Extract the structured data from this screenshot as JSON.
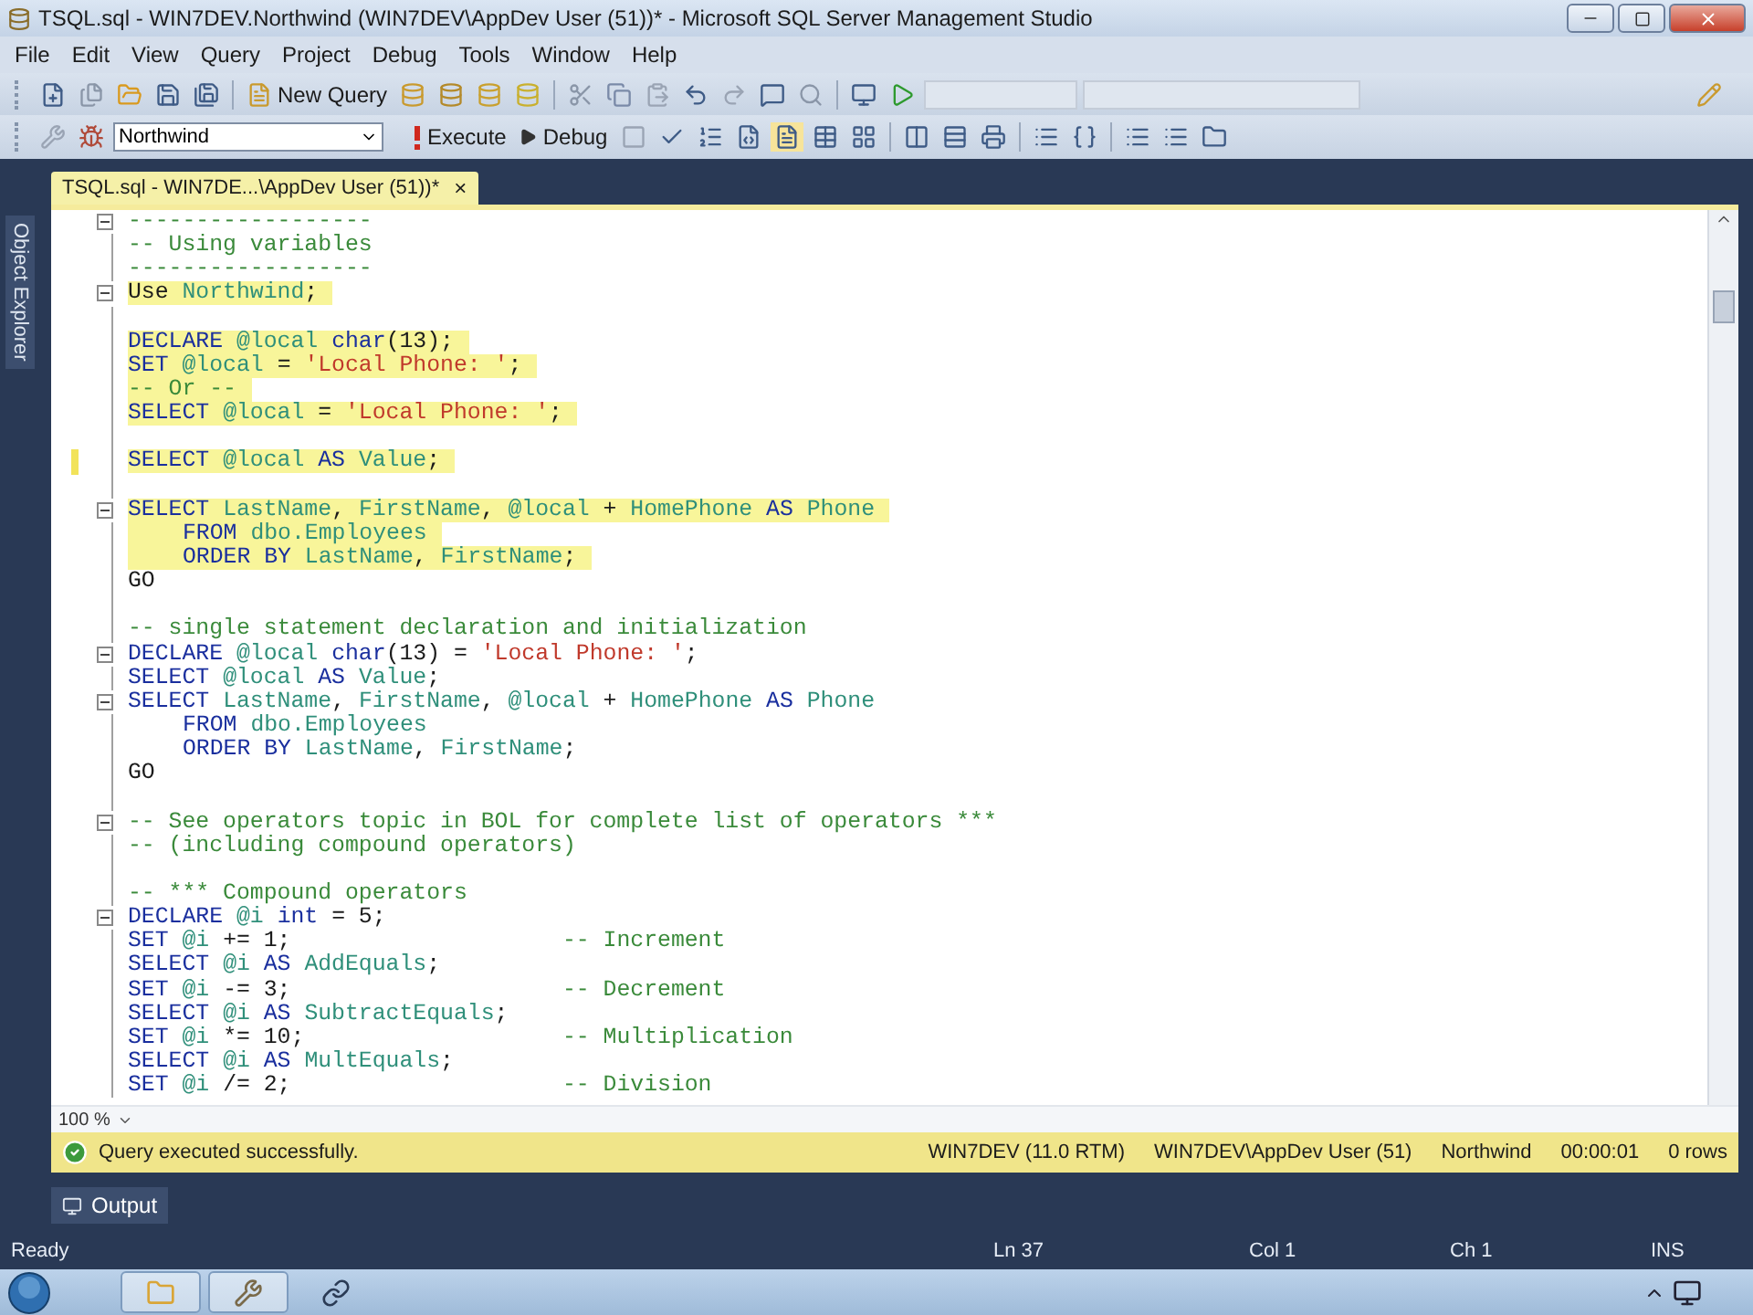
{
  "window": {
    "title": "TSQL.sql - WIN7DEV.Northwind (WIN7DEV\\AppDev User (51))* - Microsoft SQL Server Management Studio"
  },
  "menu": [
    "File",
    "Edit",
    "View",
    "Query",
    "Project",
    "Debug",
    "Tools",
    "Window",
    "Help"
  ],
  "toolbar": {
    "new_query": "New Query"
  },
  "query_toolbar": {
    "database": "Northwind",
    "execute": "Execute",
    "debug": "Debug"
  },
  "side_tabs": [
    "Object Explorer"
  ],
  "document_tabs": [
    {
      "label": "TSQL.sql - WIN7DE...\\AppDev User (51))*",
      "close": "×",
      "selected": true
    }
  ],
  "editor": {
    "zoom": "100 %",
    "lines": [
      {
        "kind": "code",
        "fold": true,
        "highlighted": false,
        "changed": false,
        "tokens": [
          {
            "kind": "comment",
            "text": "------------------"
          }
        ]
      },
      {
        "kind": "code",
        "fold": false,
        "highlighted": false,
        "changed": false,
        "tokens": [
          {
            "kind": "comment",
            "text": "-- Using variables"
          }
        ]
      },
      {
        "kind": "code",
        "fold": false,
        "highlighted": false,
        "changed": false,
        "tokens": [
          {
            "kind": "comment",
            "text": "------------------"
          }
        ]
      },
      {
        "kind": "code",
        "fold": true,
        "highlighted": true,
        "changed": false,
        "tokens": [
          {
            "kind": "plain",
            "text": "Use "
          },
          {
            "kind": "identifier",
            "text": "Northwind"
          },
          {
            "kind": "plain",
            "text": ";"
          }
        ]
      },
      {
        "kind": "blank"
      },
      {
        "kind": "code",
        "fold": false,
        "highlighted": true,
        "changed": false,
        "tokens": [
          {
            "kind": "keyword",
            "text": "DECLARE "
          },
          {
            "kind": "variable",
            "text": "@local "
          },
          {
            "kind": "keyword",
            "text": "char"
          },
          {
            "kind": "plain",
            "text": "(13);"
          }
        ]
      },
      {
        "kind": "code",
        "fold": false,
        "highlighted": true,
        "changed": false,
        "tokens": [
          {
            "kind": "keyword",
            "text": "SET "
          },
          {
            "kind": "variable",
            "text": "@local "
          },
          {
            "kind": "plain",
            "text": "= "
          },
          {
            "kind": "string",
            "text": "'Local Phone: '"
          },
          {
            "kind": "plain",
            "text": ";"
          }
        ]
      },
      {
        "kind": "code",
        "fold": false,
        "highlighted": true,
        "changed": false,
        "tokens": [
          {
            "kind": "comment",
            "text": "-- Or --"
          }
        ]
      },
      {
        "kind": "code",
        "fold": false,
        "highlighted": true,
        "changed": false,
        "tokens": [
          {
            "kind": "keyword",
            "text": "SELECT "
          },
          {
            "kind": "variable",
            "text": "@local "
          },
          {
            "kind": "plain",
            "text": "= "
          },
          {
            "kind": "string",
            "text": "'Local Phone: '"
          },
          {
            "kind": "plain",
            "text": ";"
          }
        ]
      },
      {
        "kind": "blank"
      },
      {
        "kind": "code",
        "fold": false,
        "highlighted": true,
        "changed": true,
        "tokens": [
          {
            "kind": "keyword",
            "text": "SELECT "
          },
          {
            "kind": "variable",
            "text": "@local "
          },
          {
            "kind": "keyword",
            "text": "AS "
          },
          {
            "kind": "identifier",
            "text": "Value"
          },
          {
            "kind": "plain",
            "text": ";"
          }
        ]
      },
      {
        "kind": "blank"
      },
      {
        "kind": "code",
        "fold": true,
        "highlighted": true,
        "changed": false,
        "tokens": [
          {
            "kind": "keyword",
            "text": "SELECT "
          },
          {
            "kind": "identifier",
            "text": "LastName"
          },
          {
            "kind": "plain",
            "text": ", "
          },
          {
            "kind": "identifier",
            "text": "FirstName"
          },
          {
            "kind": "plain",
            "text": ", "
          },
          {
            "kind": "variable",
            "text": "@local "
          },
          {
            "kind": "plain",
            "text": "+ "
          },
          {
            "kind": "identifier",
            "text": "HomePhone "
          },
          {
            "kind": "keyword",
            "text": "AS "
          },
          {
            "kind": "identifier",
            "text": "Phone"
          }
        ]
      },
      {
        "kind": "code",
        "indented": true,
        "fold": false,
        "highlighted": true,
        "changed": false,
        "tokens": [
          {
            "kind": "keyword",
            "text": "FROM "
          },
          {
            "kind": "identifier",
            "text": "dbo.Employees"
          }
        ]
      },
      {
        "kind": "code",
        "indented": true,
        "fold": false,
        "highlighted": true,
        "changed": false,
        "tokens": [
          {
            "kind": "keyword",
            "text": "ORDER BY "
          },
          {
            "kind": "identifier",
            "text": "LastName"
          },
          {
            "kind": "plain",
            "text": ", "
          },
          {
            "kind": "identifier",
            "text": "FirstName"
          },
          {
            "kind": "plain",
            "text": ";"
          }
        ]
      },
      {
        "kind": "code",
        "fold": false,
        "highlighted": false,
        "changed": false,
        "tokens": [
          {
            "kind": "plain",
            "text": "GO"
          }
        ]
      },
      {
        "kind": "blank"
      },
      {
        "kind": "code",
        "fold": false,
        "highlighted": false,
        "changed": false,
        "tokens": [
          {
            "kind": "comment",
            "text": "-- single statement declaration and initialization"
          }
        ]
      },
      {
        "kind": "code",
        "fold": true,
        "highlighted": false,
        "changed": false,
        "tokens": [
          {
            "kind": "keyword",
            "text": "DECLARE "
          },
          {
            "kind": "variable",
            "text": "@local "
          },
          {
            "kind": "keyword",
            "text": "char"
          },
          {
            "kind": "plain",
            "text": "(13) = "
          },
          {
            "kind": "string",
            "text": "'Local Phone: '"
          },
          {
            "kind": "plain",
            "text": ";"
          }
        ]
      },
      {
        "kind": "code",
        "fold": false,
        "highlighted": false,
        "changed": false,
        "tokens": [
          {
            "kind": "keyword",
            "text": "SELECT "
          },
          {
            "kind": "variable",
            "text": "@local "
          },
          {
            "kind": "keyword",
            "text": "AS "
          },
          {
            "kind": "identifier",
            "text": "Value"
          },
          {
            "kind": "plain",
            "text": ";"
          }
        ]
      },
      {
        "kind": "code",
        "fold": true,
        "highlighted": false,
        "changed": false,
        "tokens": [
          {
            "kind": "keyword",
            "text": "SELECT "
          },
          {
            "kind": "identifier",
            "text": "LastName"
          },
          {
            "kind": "plain",
            "text": ", "
          },
          {
            "kind": "identifier",
            "text": "FirstName"
          },
          {
            "kind": "plain",
            "text": ", "
          },
          {
            "kind": "variable",
            "text": "@local "
          },
          {
            "kind": "plain",
            "text": "+ "
          },
          {
            "kind": "identifier",
            "text": "HomePhone "
          },
          {
            "kind": "keyword",
            "text": "AS "
          },
          {
            "kind": "identifier",
            "text": "Phone"
          }
        ]
      },
      {
        "kind": "code",
        "indented": true,
        "fold": false,
        "highlighted": false,
        "changed": false,
        "tokens": [
          {
            "kind": "keyword",
            "text": "FROM "
          },
          {
            "kind": "identifier",
            "text": "dbo.Employees"
          }
        ]
      },
      {
        "kind": "code",
        "indented": true,
        "fold": false,
        "highlighted": false,
        "changed": false,
        "tokens": [
          {
            "kind": "keyword",
            "text": "ORDER BY "
          },
          {
            "kind": "identifier",
            "text": "LastName"
          },
          {
            "kind": "plain",
            "text": ", "
          },
          {
            "kind": "identifier",
            "text": "FirstName"
          },
          {
            "kind": "plain",
            "text": ";"
          }
        ]
      },
      {
        "kind": "code",
        "fold": false,
        "highlighted": false,
        "changed": false,
        "tokens": [
          {
            "kind": "plain",
            "text": "GO"
          }
        ]
      },
      {
        "kind": "blank"
      },
      {
        "kind": "code",
        "fold": true,
        "highlighted": false,
        "changed": false,
        "tokens": [
          {
            "kind": "comment",
            "text": "-- See operators topic in BOL for complete list of operators ***"
          }
        ]
      },
      {
        "kind": "code",
        "fold": false,
        "highlighted": false,
        "changed": false,
        "tokens": [
          {
            "kind": "comment",
            "text": "-- (including compound operators)"
          }
        ]
      },
      {
        "kind": "blank"
      },
      {
        "kind": "code",
        "fold": false,
        "highlighted": false,
        "changed": false,
        "tokens": [
          {
            "kind": "comment",
            "text": "-- *** Compound operators"
          }
        ]
      },
      {
        "kind": "code",
        "fold": true,
        "highlighted": false,
        "changed": false,
        "tokens": [
          {
            "kind": "keyword",
            "text": "DECLARE "
          },
          {
            "kind": "variable",
            "text": "@i "
          },
          {
            "kind": "keyword",
            "text": "int "
          },
          {
            "kind": "plain",
            "text": "= 5;"
          }
        ]
      },
      {
        "kind": "code",
        "fold": false,
        "highlighted": false,
        "changed": false,
        "tokens": [
          {
            "kind": "keyword",
            "text": "SET "
          },
          {
            "kind": "variable",
            "text": "@i "
          },
          {
            "kind": "plain",
            "text": "+= 1;                    "
          },
          {
            "kind": "comment",
            "text": "-- Increment"
          }
        ]
      },
      {
        "kind": "code",
        "fold": false,
        "highlighted": false,
        "changed": false,
        "tokens": [
          {
            "kind": "keyword",
            "text": "SELECT "
          },
          {
            "kind": "variable",
            "text": "@i "
          },
          {
            "kind": "keyword",
            "text": "AS "
          },
          {
            "kind": "identifier",
            "text": "AddEquals"
          },
          {
            "kind": "plain",
            "text": ";"
          }
        ]
      },
      {
        "kind": "code",
        "fold": false,
        "highlighted": false,
        "changed": false,
        "tokens": [
          {
            "kind": "keyword",
            "text": "SET "
          },
          {
            "kind": "variable",
            "text": "@i "
          },
          {
            "kind": "plain",
            "text": "-= 3;                    "
          },
          {
            "kind": "comment",
            "text": "-- Decrement"
          }
        ]
      },
      {
        "kind": "code",
        "fold": false,
        "highlighted": false,
        "changed": false,
        "tokens": [
          {
            "kind": "keyword",
            "text": "SELECT "
          },
          {
            "kind": "variable",
            "text": "@i "
          },
          {
            "kind": "keyword",
            "text": "AS "
          },
          {
            "kind": "identifier",
            "text": "SubtractEquals"
          },
          {
            "kind": "plain",
            "text": ";"
          }
        ]
      },
      {
        "kind": "code",
        "fold": false,
        "highlighted": false,
        "changed": false,
        "tokens": [
          {
            "kind": "keyword",
            "text": "SET "
          },
          {
            "kind": "variable",
            "text": "@i "
          },
          {
            "kind": "plain",
            "text": "*= 10;                   "
          },
          {
            "kind": "comment",
            "text": "-- Multiplication"
          }
        ]
      },
      {
        "kind": "code",
        "fold": false,
        "highlighted": false,
        "changed": false,
        "tokens": [
          {
            "kind": "keyword",
            "text": "SELECT "
          },
          {
            "kind": "variable",
            "text": "@i "
          },
          {
            "kind": "keyword",
            "text": "AS "
          },
          {
            "kind": "identifier",
            "text": "MultEquals"
          },
          {
            "kind": "plain",
            "text": ";"
          }
        ]
      },
      {
        "kind": "code",
        "fold": false,
        "highlighted": false,
        "changed": false,
        "tokens": [
          {
            "kind": "keyword",
            "text": "SET "
          },
          {
            "kind": "variable",
            "text": "@i "
          },
          {
            "kind": "plain",
            "text": "/= 2;                    "
          },
          {
            "kind": "comment",
            "text": "-- Division"
          }
        ]
      }
    ]
  },
  "query_status": {
    "message": "Query executed successfully.",
    "fields": [
      "WIN7DEV (11.0 RTM)",
      "WIN7DEV\\AppDev User (51)",
      "Northwind",
      "00:00:01",
      "0 rows"
    ]
  },
  "bottom_tabs": [
    "Output"
  ],
  "status_bar": {
    "message": "Ready",
    "fields": [
      "Ln 37",
      "Col 1",
      "Ch 1",
      "INS"
    ]
  }
}
